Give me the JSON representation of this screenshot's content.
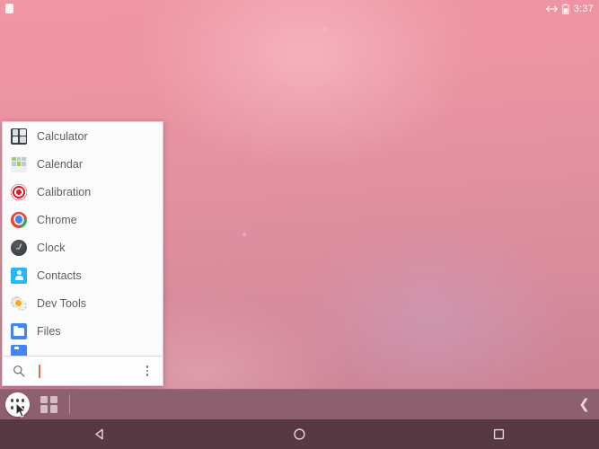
{
  "status_bar": {
    "notification_icon": "notification-square-icon",
    "rotation_icon": "horizontal-arrows-icon",
    "battery_icon": "battery-icon",
    "clock": "3:37"
  },
  "app_drawer": {
    "apps": [
      {
        "label": "Calculator",
        "icon": "calculator-icon"
      },
      {
        "label": "Calendar",
        "icon": "calendar-icon"
      },
      {
        "label": "Calibration",
        "icon": "calibration-icon"
      },
      {
        "label": "Chrome",
        "icon": "chrome-icon"
      },
      {
        "label": "Clock",
        "icon": "clock-icon"
      },
      {
        "label": "Contacts",
        "icon": "contacts-icon"
      },
      {
        "label": "Dev Tools",
        "icon": "dev-tools-icon"
      },
      {
        "label": "Files",
        "icon": "files-icon"
      }
    ],
    "clipped_item": {
      "label": "",
      "icon": "partially-visible-app-icon"
    },
    "search": {
      "icon": "search-icon",
      "value": "",
      "placeholder": "",
      "overflow_icon": "overflow-menu-icon",
      "caret_color": "#e8733f"
    }
  },
  "taskbar": {
    "all_apps_icon": "all-apps-dots-icon",
    "grid_icon": "app-grid-icon",
    "chevron_icon": "chevron-left-icon",
    "chevron_glyph": "❮"
  },
  "nav_bar": {
    "back": "back-triangle-icon",
    "home": "home-circle-icon",
    "recents": "recents-square-icon"
  },
  "colors": {
    "wallpaper_top": "#ef96a4",
    "wallpaper_bottom": "#c8818f",
    "taskbar": "#8d6070",
    "nav_bar": "#573944",
    "panel": "#fbfbfb",
    "label_text": "#5d5d5d"
  }
}
